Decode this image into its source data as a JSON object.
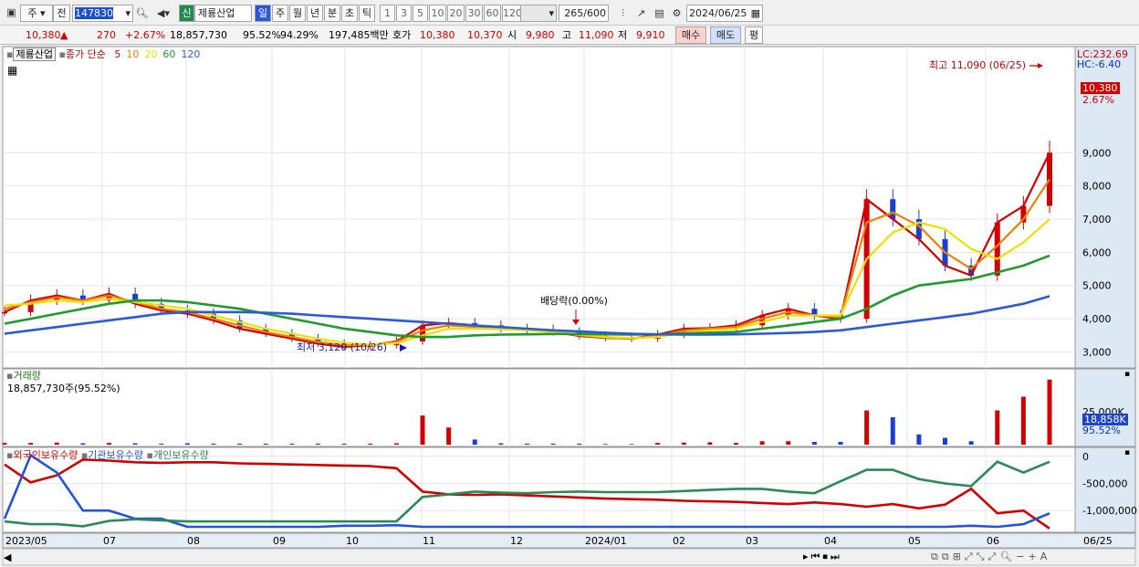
{
  "toolbar": {
    "market": "주",
    "prev": "전",
    "code": "147830",
    "name_badge": "신",
    "name": "제룡산업",
    "periods": [
      "일",
      "주",
      "월",
      "년",
      "분",
      "초",
      "틱"
    ],
    "active_period": "일",
    "minutes": [
      "1",
      "3",
      "5",
      "10",
      "20",
      "30",
      "60",
      "120"
    ],
    "count": "265",
    "total": "/600",
    "date": "2024/06/25"
  },
  "quote": {
    "price": "10,380",
    "change": "270",
    "change_pct": "+2.67%",
    "volume": "18,857,730",
    "vol_ratio": "95.52%",
    "ratio2": "94.29%",
    "amount": "197,485백만",
    "ask_label": "호가",
    "ask": "10,380",
    "bid": "10,370",
    "open_label": "시",
    "open": "9,980",
    "high_label": "고",
    "high": "11,090",
    "low_label": "저",
    "low": "9,910",
    "buy": "매수",
    "sell": "매도",
    "avg": "평"
  },
  "price_panel": {
    "stock": "제룡산업",
    "ma_prefix": "종가 단순",
    "ma_periods": [
      "5",
      "10",
      "20",
      "60",
      "120"
    ],
    "lc": "LC:232.69",
    "hc": "HC:-6.40",
    "current": "10,380",
    "current_pct": "2.67%",
    "high_label": "최고 11,090 (06/25)",
    "low_label": "최저 3,120 (10/26)",
    "dividend": "배당락(0.00%)"
  },
  "volume_panel": {
    "title": "거래량",
    "info": "18,857,730주(95.52%)",
    "current": "18,858K",
    "pct": "95.52%"
  },
  "holding_panel": {
    "items": [
      "외국인보유수량",
      "기관보유수량",
      "개인보유수량"
    ]
  },
  "x_axis": {
    "labels": [
      "2023/05",
      "07",
      "08",
      "09",
      "10",
      "11",
      "12",
      "2024/01",
      "02",
      "03",
      "04",
      "05",
      "06",
      "06/25"
    ]
  },
  "colors": {
    "up": "#d20000",
    "down": "#1a3fd8",
    "ma5": "#d40000",
    "ma10": "#f08000",
    "ma20": "#f0e000",
    "ma60": "#1e9a2e",
    "ma120": "#2a5ad8",
    "foreign": "#d40000",
    "inst": "#2255dd",
    "indiv": "#2a8a55"
  },
  "chart_data": [
    {
      "type": "line",
      "title": "",
      "ylabel": "",
      "y_ticks": [
        3000,
        4000,
        5000,
        6000,
        7000,
        8000,
        9000
      ],
      "ylim": [
        2600,
        11950
      ],
      "x_months": [
        "2023/05",
        "07",
        "08",
        "09",
        "10",
        "11",
        "12",
        "2024/01",
        "02",
        "03",
        "04",
        "05",
        "06"
      ],
      "series": [
        {
          "name": "5",
          "values": [
            4200,
            4550,
            4700,
            4550,
            4750,
            4450,
            4250,
            4150,
            3950,
            3700,
            3550,
            3400,
            3250,
            3150,
            3200,
            3320,
            3800,
            3870,
            3800,
            3700,
            3680,
            3600,
            3480,
            3420,
            3400,
            3520,
            3700,
            3720,
            3800,
            4100,
            4300,
            4100,
            4000,
            7600,
            7000,
            6400,
            5600,
            5300,
            6900,
            7400,
            9000
          ]
        },
        {
          "name": "10",
          "values": [
            4300,
            4500,
            4650,
            4550,
            4700,
            4500,
            4300,
            4200,
            4000,
            3800,
            3600,
            3450,
            3300,
            3200,
            3200,
            3300,
            3650,
            3800,
            3750,
            3700,
            3650,
            3600,
            3500,
            3430,
            3400,
            3480,
            3650,
            3700,
            3750,
            4000,
            4200,
            4100,
            4050,
            6900,
            7200,
            6800,
            6000,
            5500,
            6200,
            7000,
            8200
          ]
        },
        {
          "name": "20",
          "values": [
            4400,
            4450,
            4550,
            4500,
            4600,
            4500,
            4400,
            4300,
            4100,
            3900,
            3700,
            3550,
            3400,
            3280,
            3220,
            3260,
            3500,
            3700,
            3700,
            3680,
            3650,
            3600,
            3520,
            3450,
            3420,
            3450,
            3580,
            3650,
            3700,
            3900,
            4100,
            4100,
            4100,
            5800,
            6600,
            6900,
            6700,
            6100,
            5800,
            6300,
            7000
          ]
        },
        {
          "name": "60",
          "values": [
            3850,
            4000,
            4150,
            4300,
            4450,
            4550,
            4550,
            4500,
            4400,
            4300,
            4150,
            4000,
            3850,
            3700,
            3600,
            3500,
            3450,
            3450,
            3500,
            3520,
            3530,
            3540,
            3540,
            3530,
            3520,
            3530,
            3560,
            3580,
            3600,
            3700,
            3800,
            3900,
            4000,
            4300,
            4700,
            5000,
            5100,
            5200,
            5400,
            5600,
            5900
          ]
        },
        {
          "name": "120",
          "values": [
            3550,
            3650,
            3750,
            3850,
            3950,
            4050,
            4150,
            4200,
            4200,
            4200,
            4180,
            4150,
            4100,
            4050,
            4000,
            3950,
            3900,
            3850,
            3800,
            3750,
            3700,
            3650,
            3620,
            3580,
            3550,
            3530,
            3520,
            3520,
            3530,
            3550,
            3570,
            3600,
            3650,
            3750,
            3850,
            3950,
            4050,
            4150,
            4300,
            4450,
            4680
          ]
        }
      ]
    },
    {
      "type": "bar",
      "title": "거래량",
      "y_ticks": [
        25000
      ],
      "values": [
        0.5,
        0.5,
        0.6,
        0.4,
        0.5,
        0.4,
        0.3,
        0.4,
        0.3,
        0.3,
        0.3,
        0.3,
        0.3,
        0.3,
        0.3,
        0.4,
        8.5,
        5,
        1.5,
        0.4,
        0.3,
        0.3,
        0.3,
        0.2,
        0.2,
        0.5,
        0.6,
        0.7,
        0.5,
        1,
        1,
        0.8,
        0.8,
        10,
        8,
        3,
        2,
        1,
        10,
        14,
        19
      ]
    },
    {
      "type": "line",
      "title": "보유수량",
      "y_ticks": [
        0,
        -500000,
        -1000000
      ],
      "ylim": [
        -1350000,
        80000
      ],
      "series": [
        {
          "name": "외국인보유수량",
          "values": [
            -150000,
            -480000,
            -350000,
            -60000,
            -80000,
            -110000,
            -120000,
            -110000,
            -110000,
            -130000,
            -140000,
            -150000,
            -160000,
            -170000,
            -180000,
            -220000,
            -650000,
            -700000,
            -710000,
            -700000,
            -720000,
            -740000,
            -760000,
            -780000,
            -790000,
            -800000,
            -820000,
            -830000,
            -840000,
            -860000,
            -880000,
            -850000,
            -880000,
            -930000,
            -880000,
            -960000,
            -890000,
            -600000,
            -1050000,
            -1000000,
            -1330000
          ]
        },
        {
          "name": "기관보유수량",
          "values": [
            -1150000,
            20000,
            -300000,
            -1000000,
            -1000000,
            -1150000,
            -1150000,
            -1300000,
            -1300000,
            -1300000,
            -1300000,
            -1300000,
            -1300000,
            -1280000,
            -1280000,
            -1270000,
            -1300000,
            -1300000,
            -1300000,
            -1300000,
            -1300000,
            -1300000,
            -1300000,
            -1300000,
            -1300000,
            -1300000,
            -1300000,
            -1300000,
            -1300000,
            -1300000,
            -1300000,
            -1300000,
            -1300000,
            -1300000,
            -1300000,
            -1300000,
            -1300000,
            -1280000,
            -1300000,
            -1250000,
            -1050000
          ]
        },
        {
          "name": "개인보유수량",
          "values": [
            -1200000,
            -1250000,
            -1250000,
            -1290000,
            -1190000,
            -1160000,
            -1180000,
            -1200000,
            -1200000,
            -1200000,
            -1200000,
            -1200000,
            -1200000,
            -1200000,
            -1200000,
            -1200000,
            -750000,
            -700000,
            -650000,
            -670000,
            -680000,
            -660000,
            -650000,
            -660000,
            -660000,
            -660000,
            -640000,
            -620000,
            -600000,
            -600000,
            -650000,
            -680000,
            -460000,
            -250000,
            -250000,
            -420000,
            -500000,
            -550000,
            -100000,
            -300000,
            -100000
          ]
        }
      ]
    }
  ]
}
